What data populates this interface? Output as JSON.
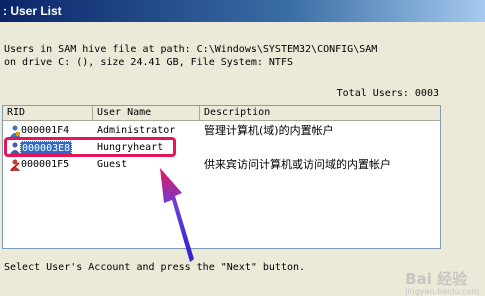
{
  "window": {
    "title": ": User List"
  },
  "info": {
    "line1": "Users in SAM hive file at path: C:\\Windows\\SYSTEM32\\CONFIG\\SAM",
    "line2": "on drive C: (), size 24.41 GB, File System: NTFS"
  },
  "total": "Total Users: 0003",
  "list": {
    "columns": [
      "RID",
      "User Name",
      "Description"
    ],
    "rows": [
      {
        "rid": "000001F4",
        "name": "Administrator",
        "desc": "管理计算机(域)的内置帐户",
        "icon": "user-admin-icon",
        "selected": false
      },
      {
        "rid": "000003E8",
        "name": "Hungryheart",
        "desc": "",
        "icon": "user-icon",
        "selected": true
      },
      {
        "rid": "000001F5",
        "name": "Guest",
        "desc": "供来宾访问计算机或访问域的内置帐户",
        "icon": "user-guest-icon",
        "selected": false
      }
    ]
  },
  "footer": {
    "hint": "Select User's Account and press the \"Next\" button."
  },
  "watermark": {
    "main": "Bai 经验",
    "sub": "jingyan.baidu.com"
  },
  "colors": {
    "highlight": "#e6155a",
    "arrow": "#3b2bd6",
    "selection": "#316ac5"
  }
}
